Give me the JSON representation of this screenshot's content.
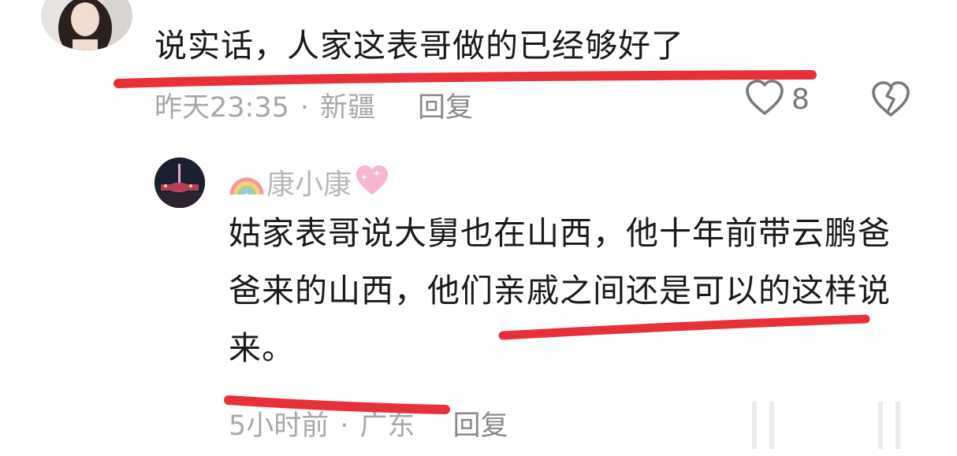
{
  "comment": {
    "text": "说实话，人家这表哥做的已经够好了",
    "time": "昨天23:35",
    "location": "新疆",
    "reply_label": "回复",
    "like_count": "8"
  },
  "reply": {
    "username": "康小康",
    "text": "姑家表哥说大舅也在山西，他十年前带云鹏爸爸来的山西，他们亲戚之间还是可以的这样说来。",
    "time": "5小时前",
    "location": "广东",
    "reply_label": "回复"
  },
  "icons": {
    "like": "heart-outline-icon",
    "dislike": "broken-heart-icon",
    "username_prefix": "rainbow-emoji-icon",
    "username_suffix": "sparkling-heart-emoji-icon"
  },
  "colors": {
    "annotation_underline": "#e8303a",
    "meta_text": "#a8a8a8",
    "username_text": "#b8b8b8"
  }
}
